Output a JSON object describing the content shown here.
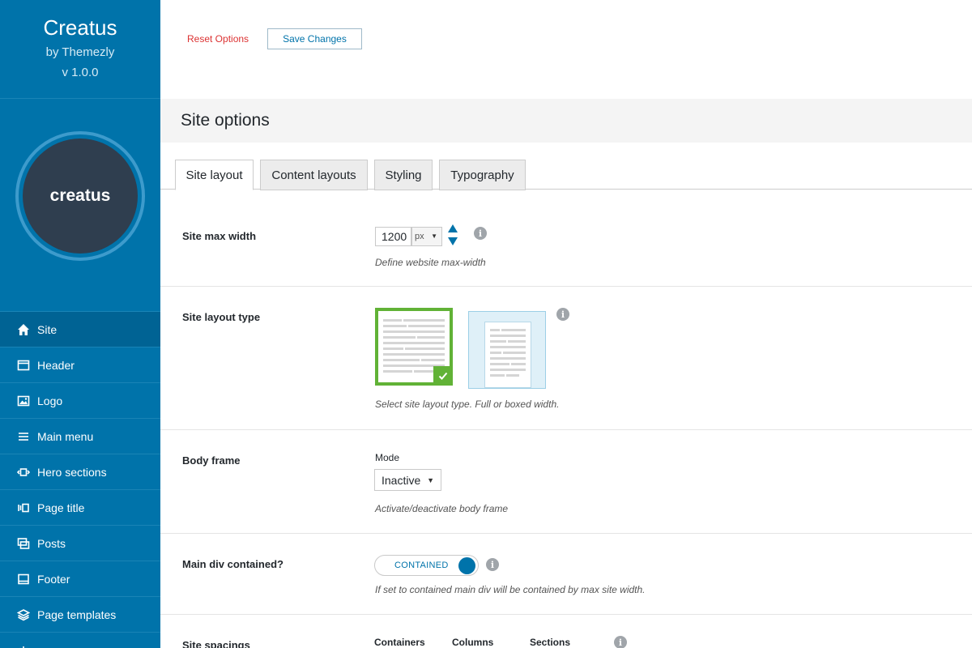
{
  "sidebar": {
    "brand_name": "Creatus",
    "brand_by": "by Themezly",
    "version": "v 1.0.0",
    "logo_text": "creatus",
    "items": [
      {
        "label": "Site",
        "icon": "home-icon",
        "active": true
      },
      {
        "label": "Header",
        "icon": "window-icon",
        "active": false
      },
      {
        "label": "Logo",
        "icon": "image-icon",
        "active": false
      },
      {
        "label": "Main menu",
        "icon": "menu-icon",
        "active": false
      },
      {
        "label": "Hero sections",
        "icon": "hero-icon",
        "active": false
      },
      {
        "label": "Page title",
        "icon": "page-title-icon",
        "active": false
      },
      {
        "label": "Posts",
        "icon": "posts-icon",
        "active": false
      },
      {
        "label": "Footer",
        "icon": "footer-icon",
        "active": false
      },
      {
        "label": "Page templates",
        "icon": "layers-icon",
        "active": false
      }
    ]
  },
  "toolbar": {
    "reset_label": "Reset Options",
    "save_label": "Save Changes"
  },
  "section": {
    "title": "Site options",
    "tabs": [
      {
        "label": "Site layout",
        "active": true
      },
      {
        "label": "Content layouts",
        "active": false
      },
      {
        "label": "Styling",
        "active": false
      },
      {
        "label": "Typography",
        "active": false
      }
    ]
  },
  "options": {
    "max_width": {
      "label": "Site max width",
      "value": "1200",
      "unit": "px",
      "desc": "Define website max-width"
    },
    "layout_type": {
      "label": "Site layout type",
      "selected": "full",
      "desc": "Select site layout type. Full or boxed width."
    },
    "body_frame": {
      "label": "Body frame",
      "mode_label": "Mode",
      "mode_value": "Inactive",
      "desc": "Activate/deactivate body frame"
    },
    "main_div": {
      "label": "Main div contained?",
      "toggle_text": "CONTAINED",
      "desc": "If set to contained main div will be contained by max site width."
    },
    "spacings": {
      "label": "Site spacings",
      "columns": [
        "Containers",
        "Columns",
        "Sections"
      ]
    }
  },
  "colors": {
    "sidebar": "#0073aa",
    "accent": "#0073aa",
    "selected": "#61b236",
    "reset": "#dc3232"
  }
}
